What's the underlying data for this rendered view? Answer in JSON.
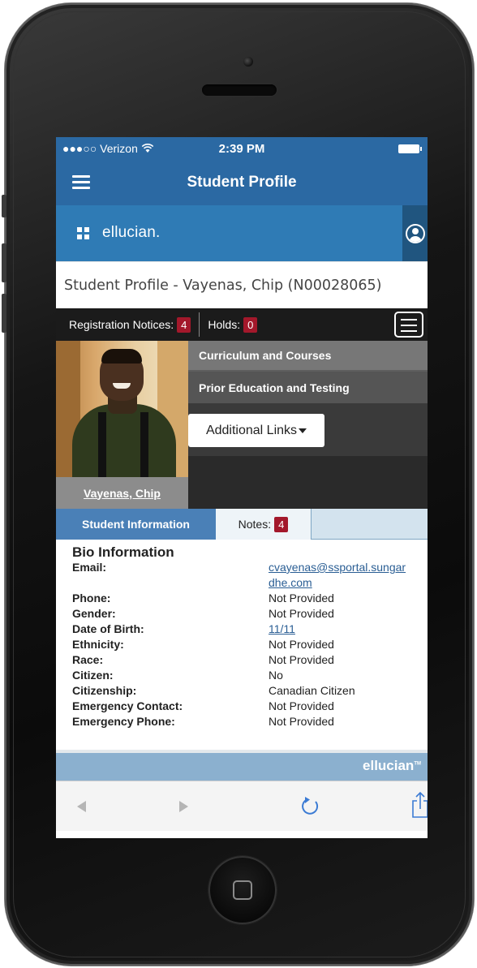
{
  "status_bar": {
    "carrier": "●●●○○ Verizon",
    "wifi": "wifi-icon",
    "time": "2:39 PM"
  },
  "nav": {
    "title": "Student Profile"
  },
  "brand": {
    "name": "ellucian."
  },
  "page": {
    "heading": "Student Profile - Vayenas, Chip (N00028065)"
  },
  "notices": {
    "registration_label": "Registration Notices:",
    "registration_count": "4",
    "holds_label": "Holds:",
    "holds_count": "0"
  },
  "profile": {
    "name": "Vayenas, Chip",
    "menu": [
      {
        "label": "Curriculum and Courses"
      },
      {
        "label": "Prior Education and Testing"
      }
    ],
    "links_button": "Additional Links"
  },
  "tabs": [
    {
      "label": "Student Information",
      "active": true
    },
    {
      "label": "Notes:",
      "badge": "4"
    }
  ],
  "bio": {
    "title": "Bio Information",
    "rows": [
      {
        "label": "Email:",
        "value": "cvayenas@ssportal.sungardhe.com",
        "link": true
      },
      {
        "label": "Phone:",
        "value": "Not Provided"
      },
      {
        "label": "Gender:",
        "value": "Not Provided"
      },
      {
        "label": "Date of Birth:",
        "value": "11/11",
        "link": true
      },
      {
        "label": "Ethnicity:",
        "value": "Not Provided"
      },
      {
        "label": "Race:",
        "value": "Not Provided"
      },
      {
        "label": "Citizen:",
        "value": "No"
      },
      {
        "label": "Citizenship:",
        "value": "Canadian Citizen"
      },
      {
        "label": "Emergency Contact:",
        "value": "Not Provided"
      },
      {
        "label": "Emergency Phone:",
        "value": "Not Provided"
      }
    ]
  },
  "footer": {
    "logo": "ellucian",
    "tm": "TM"
  },
  "colors": {
    "header_blue": "#2b69a3",
    "brand_blue": "#2f7bb5",
    "badge_red": "#a3182b",
    "tab_blue": "#4a80b7"
  }
}
